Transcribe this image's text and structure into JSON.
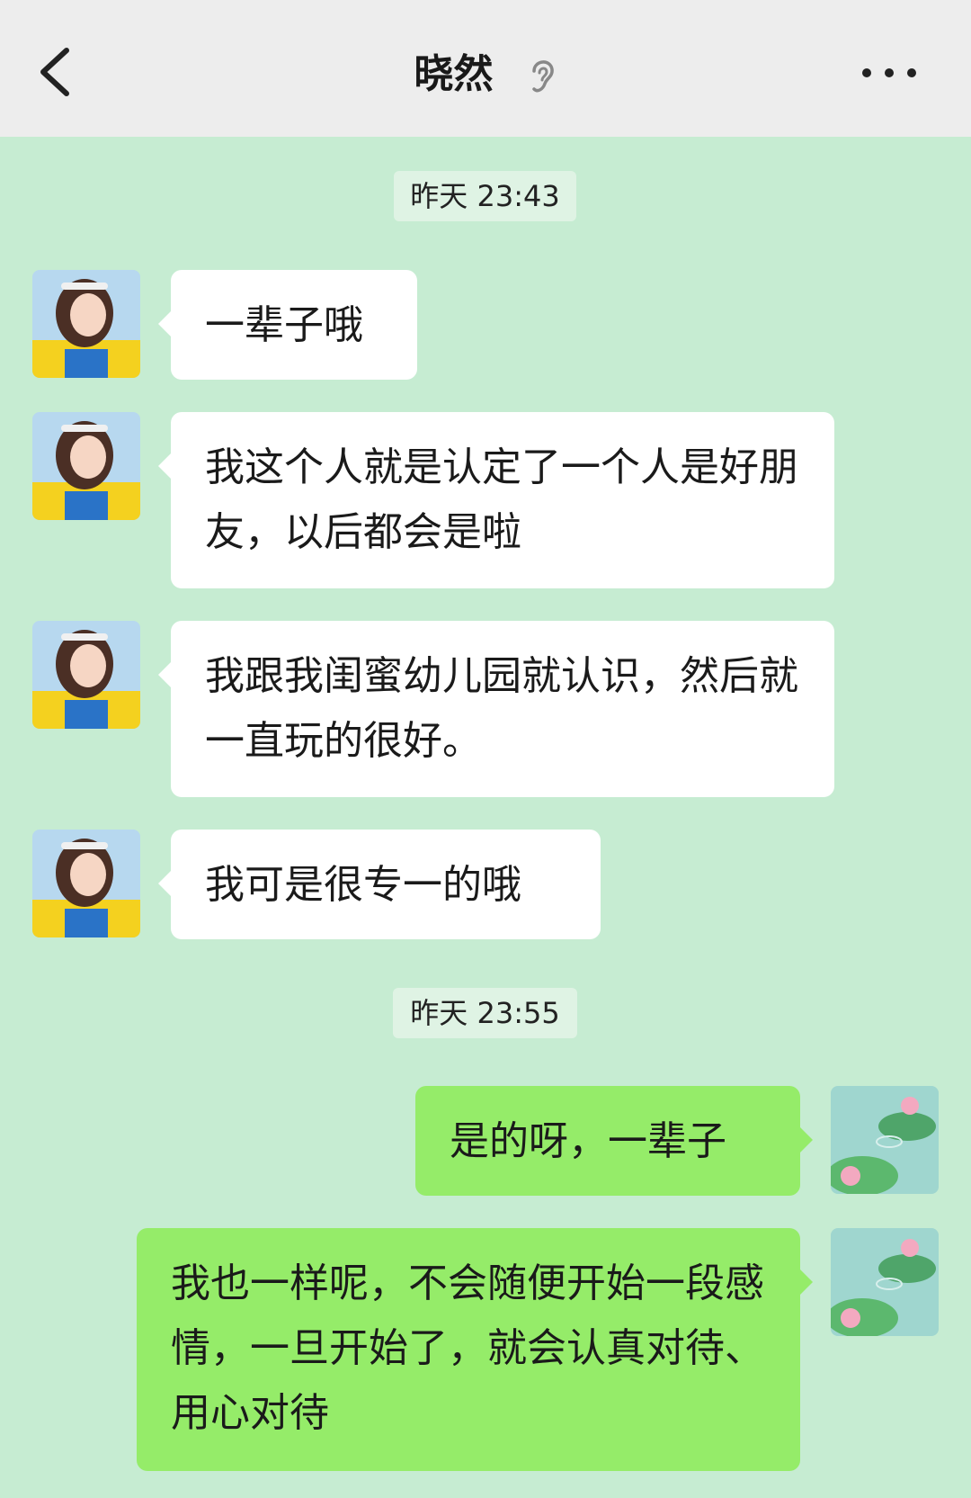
{
  "header": {
    "title": "晓然",
    "back_icon": "chevron-left-icon",
    "ear_icon": "ear-icon",
    "more_icon": "more-dots-icon"
  },
  "chat": {
    "timestamps": [
      "昨天 23:43",
      "昨天 23:55"
    ],
    "messages": [
      {
        "from": "contact",
        "text": "一辈子哦"
      },
      {
        "from": "contact",
        "text": "我这个人就是认定了一个人是好朋友，以后都会是啦"
      },
      {
        "from": "contact",
        "text": "我跟我闺蜜幼儿园就认识，然后就一直玩的很好。"
      },
      {
        "from": "contact",
        "text": "我可是很专一的哦"
      },
      {
        "from": "me",
        "text": "是的呀，一辈子"
      },
      {
        "from": "me",
        "text": "我也一样呢，不会随便开始一段感情，一旦开始了，就会认真对待、用心对待"
      }
    ]
  },
  "colors": {
    "header_bg": "#ededed",
    "chat_bg": "#c6ecd2",
    "incoming_bubble": "#ffffff",
    "outgoing_bubble": "#95ec69"
  }
}
